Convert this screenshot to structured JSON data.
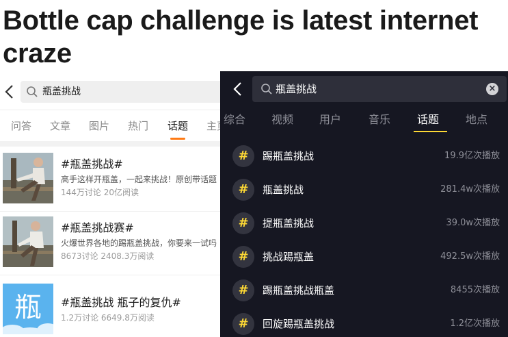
{
  "headline": "Bottle cap challenge is latest internet craze",
  "left_app": {
    "search_query": "瓶盖挑战",
    "tabs": [
      "问答",
      "文章",
      "图片",
      "热门",
      "话题",
      "主页"
    ],
    "active_tab": "话题",
    "results": [
      {
        "title": "#瓶盖挑战#",
        "desc": "高手这样开瓶盖，一起来挑战！原创带话题",
        "meta": "144万讨论 20亿阅读",
        "thumb": "photo"
      },
      {
        "title": "#瓶盖挑战赛#",
        "desc": "火爆世界各地的踢瓶盖挑战，你要来一试吗",
        "meta": "8673讨论 2408.3万阅读",
        "thumb": "photo"
      },
      {
        "title": "#瓶盖挑战 瓶子的复仇#",
        "desc": "",
        "meta": "1.2万讨论 6649.8万阅读",
        "thumb": "瓶"
      }
    ],
    "colors": {
      "accent": "#ff7a14",
      "tile": "#5ab3ee"
    }
  },
  "right_app": {
    "search_query": "瓶盖挑战",
    "clear_icon": "clear-icon",
    "tabs": [
      "综合",
      "视频",
      "用户",
      "音乐",
      "话题",
      "地点"
    ],
    "active_tab": "话题",
    "topics": [
      {
        "name": "踢瓶盖挑战",
        "plays": "19.9亿次播放"
      },
      {
        "name": "瓶盖挑战",
        "plays": "281.4w次播放"
      },
      {
        "name": "提瓶盖挑战",
        "plays": "39.0w次播放"
      },
      {
        "name": "挑战踢瓶盖",
        "plays": "492.5w次播放"
      },
      {
        "name": "踢瓶盖挑战瓶盖",
        "plays": "8455次播放"
      },
      {
        "name": "回旋踢瓶盖挑战",
        "plays": "1.2亿次播放"
      }
    ],
    "hash_symbol": "#",
    "colors": {
      "background": "#161722",
      "accent": "#fdd835"
    }
  }
}
